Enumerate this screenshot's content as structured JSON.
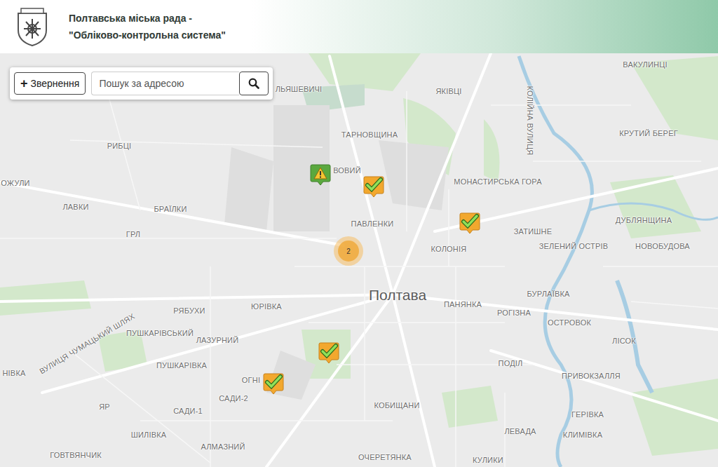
{
  "header": {
    "title_line1": "Полтавська міська рада -",
    "title_line2": "\"Обліково-контрольна система\""
  },
  "toolbar": {
    "add_icon": "+",
    "add_label": "Звернення",
    "search": {
      "placeholder": "Пошук за адресою"
    }
  },
  "map": {
    "city": "Полтава",
    "labels": [
      "ВАКУЛИНЦІ",
      "ЯКІВЦІ",
      "КОЛІЙНА ВУЛИЦЯ",
      "ЛЬЯШЕВИЧІ",
      "ТАРНОВЩИНА",
      "КРУТИЙ БЕРЕГ",
      "РИБЦІ",
      "ВОВИЙ",
      "ОЖУЛИ",
      "МОНАСТИРСЬКА ГОРА",
      "ЛАВКИ",
      "БРАЇЛКИ",
      "ПАВЛЕНКИ",
      "ДУБЛЯНЩИНА",
      "ГРЛ",
      "ЗАТИШНЕ",
      "КОЛОНІЯ",
      "ЗЕЛЕНИЙ ОСТРІВ",
      "НОВОБУДОВА",
      "БУРЛАЇВКА",
      "ЮРІВКА",
      "ПАНЯНКА",
      "РОГІЗНА",
      "РЯБУХИ",
      "ВУЛИЦЯ ЧУМАЦЬКИЙ ШЛЯХ",
      "ОСТРОВОК",
      "ПУШКАРІВСЬКИЙ",
      "ЛАЗУРНИЙ",
      "ЛІСОК",
      "НІВКА",
      "ПУШКАРІВКА",
      "ПОДІЛ",
      "ОГНІ",
      "ПРИВОКЗАЛЛЯ",
      "САДИ-2",
      "КОБИЩАНИ",
      "САДИ-1",
      "ЯР",
      "ГЕРІВКА",
      "ЛЕВАДА",
      "ШИЛІВКА",
      "КЛИМІВКА",
      "АЛМАЗНИЙ",
      "ГОВТВЯНЧИК",
      "ОЧЕРЕТЯНКА",
      "КУЛИКИ"
    ],
    "markers": [
      {
        "kind": "warning"
      },
      {
        "kind": "resolved"
      },
      {
        "kind": "resolved"
      },
      {
        "kind": "resolved"
      },
      {
        "kind": "resolved"
      },
      {
        "kind": "cluster",
        "count": "2"
      }
    ]
  }
}
